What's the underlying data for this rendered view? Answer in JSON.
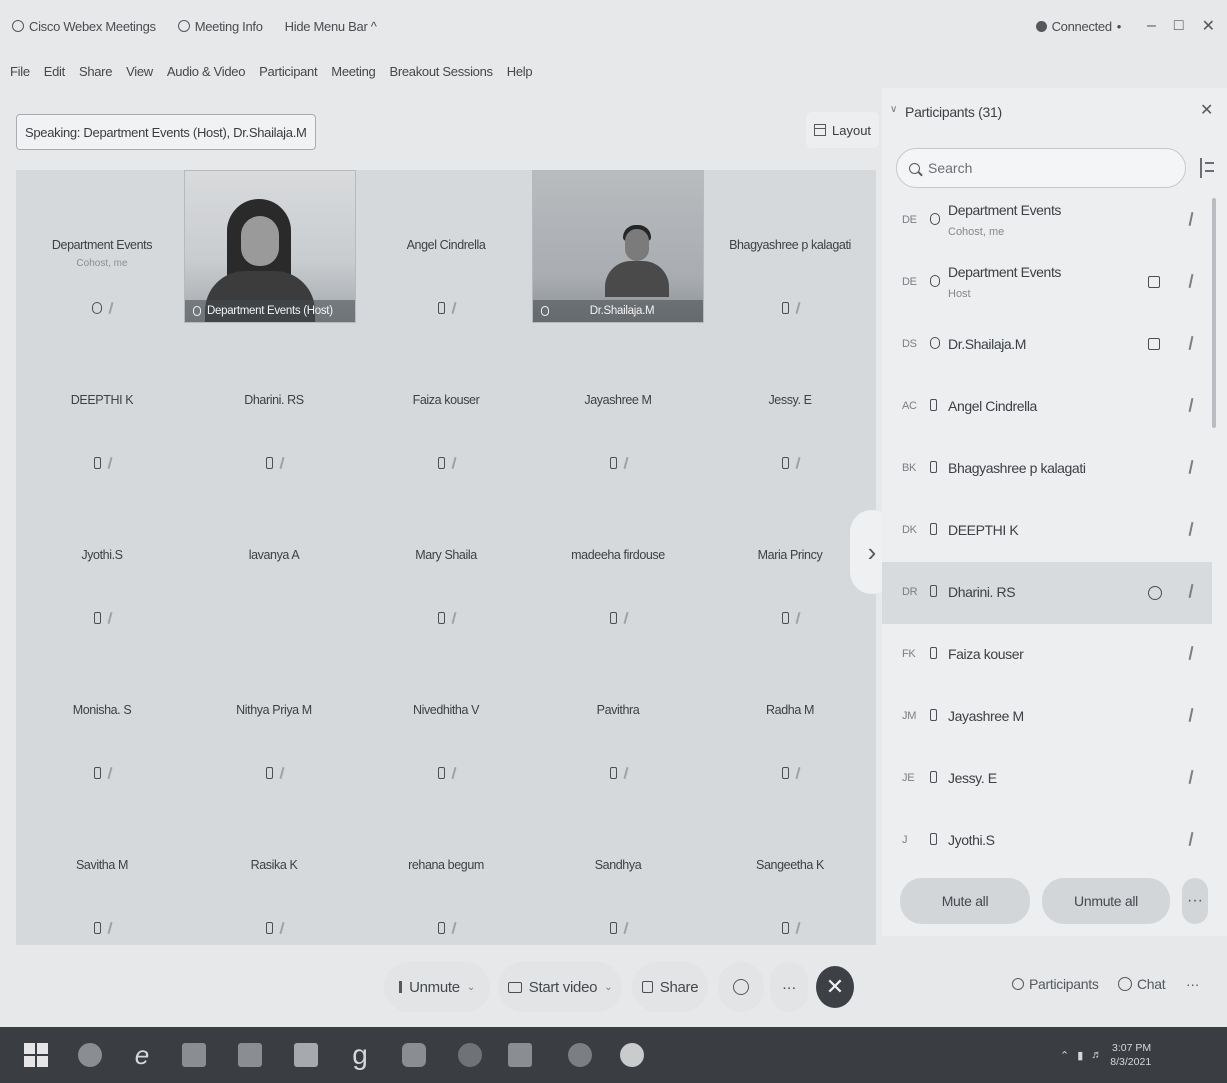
{
  "titlebar": {
    "app_name": "Cisco Webex Meetings",
    "meeting_info": "Meeting Info",
    "hide_menu": "Hide Menu Bar ^",
    "status": "Connected",
    "status_chevron": "•",
    "minimize": "–",
    "maximize": "□",
    "close": "✕"
  },
  "menubar": [
    "File",
    "Edit",
    "Share",
    "View",
    "Audio & Video",
    "Participant",
    "Meeting",
    "Breakout Sessions",
    "Help"
  ],
  "stage": {
    "speaking": "Speaking: Department Events (Host), Dr.Shailaja.M",
    "layout_label": "Layout",
    "tiles": [
      {
        "name": "Department Events",
        "sub": "Cohost, me"
      },
      {
        "name": "Department Events (Host)",
        "video": true
      },
      {
        "name": "Angel Cindrella"
      },
      {
        "name": "Dr.Shailaja.M",
        "video": true
      },
      {
        "name": "Bhagyashree p kalagati"
      },
      {
        "name": "DEEPTHI K"
      },
      {
        "name": "Dharini. RS"
      },
      {
        "name": "Faiza kouser"
      },
      {
        "name": "Jayashree M"
      },
      {
        "name": "Jessy. E"
      },
      {
        "name": "Jyothi.S"
      },
      {
        "name": "lavanya A"
      },
      {
        "name": "Mary Shaila"
      },
      {
        "name": "madeeha firdouse"
      },
      {
        "name": "Maria Princy"
      },
      {
        "name": "Monisha. S"
      },
      {
        "name": "Nithya Priya M"
      },
      {
        "name": "Nivedhitha V"
      },
      {
        "name": "Pavithra"
      },
      {
        "name": "Radha M"
      },
      {
        "name": "Savitha M"
      },
      {
        "name": "Rasika K"
      },
      {
        "name": "rehana begum"
      },
      {
        "name": "Sandhya"
      },
      {
        "name": "Sangeetha K"
      }
    ],
    "next_arrow": "›"
  },
  "controls": {
    "unmute": "Unmute",
    "start_video": "Start video",
    "share": "Share",
    "end": "✕",
    "participants": "Participants",
    "chat": "Chat",
    "more": "···"
  },
  "panel": {
    "title": "Participants (31)",
    "collapse": "∨",
    "close": "✕",
    "search_placeholder": "Search",
    "participants": [
      {
        "initials": "DE",
        "name": "Department Events",
        "sub": "Cohost, me",
        "mic": "audio"
      },
      {
        "initials": "DE",
        "name": "Department Events",
        "sub": "Host",
        "mic": "audio",
        "video": true
      },
      {
        "initials": "DS",
        "name": "Dr.Shailaja.M",
        "mic": "audio",
        "video": true
      },
      {
        "initials": "AC",
        "name": "Angel Cindrella",
        "mic": "muted"
      },
      {
        "initials": "BK",
        "name": "Bhagyashree p kalagati",
        "mic": "muted"
      },
      {
        "initials": "DK",
        "name": "DEEPTHI K",
        "mic": "muted"
      },
      {
        "initials": "DR",
        "name": "Dharini. RS",
        "mic": "muted",
        "highlighted": true,
        "circle": true
      },
      {
        "initials": "FK",
        "name": "Faiza kouser",
        "mic": "muted"
      },
      {
        "initials": "JM",
        "name": "Jayashree M",
        "mic": "muted"
      },
      {
        "initials": "JE",
        "name": "Jessy. E",
        "mic": "muted"
      },
      {
        "initials": "J",
        "name": "Jyothi.S",
        "mic": "muted"
      }
    ],
    "mute_all": "Mute all",
    "unmute_all": "Unmute all",
    "more": "···"
  },
  "taskbar": {
    "time": "3:07 PM",
    "date": "8/3/2021"
  }
}
